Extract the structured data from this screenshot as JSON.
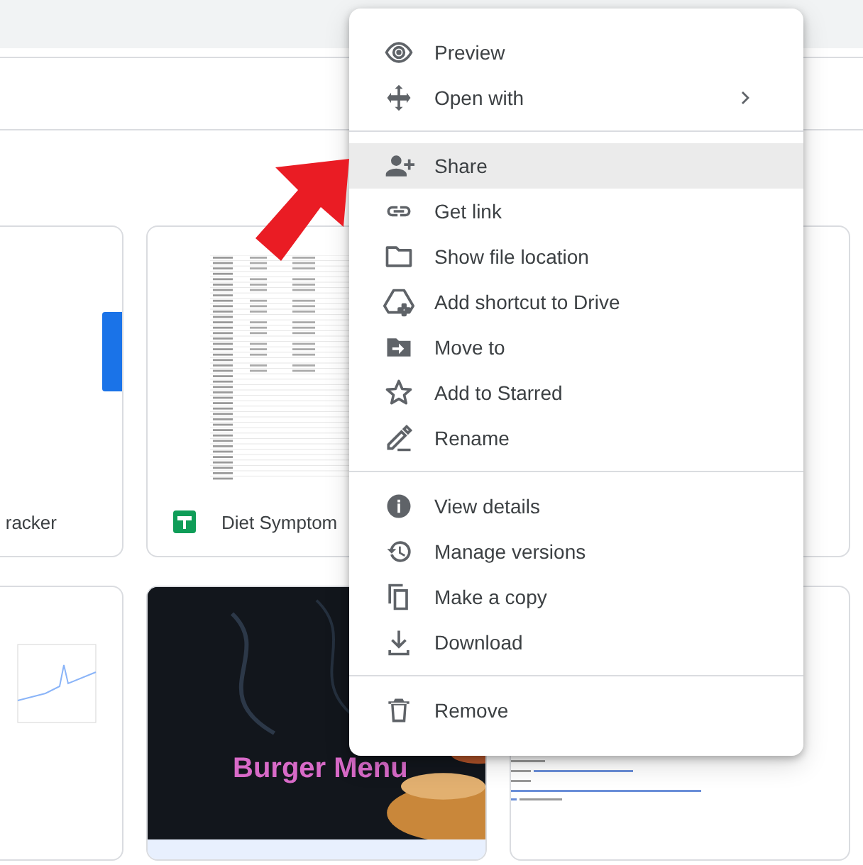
{
  "cards": [
    {
      "caption": "racker",
      "kind": "blank"
    },
    {
      "caption": "Diet Symptom",
      "kind": "sheet"
    },
    {
      "kind": "hidden"
    },
    {
      "kind": "chart"
    },
    {
      "kind": "slides",
      "title": "Burger Menu"
    },
    {
      "kind": "doc"
    }
  ],
  "menu": {
    "groups": [
      [
        {
          "label": "Preview",
          "selected": false,
          "submenu": false
        },
        {
          "label": "Open with",
          "selected": false,
          "submenu": true
        }
      ],
      [
        {
          "label": "Share",
          "selected": true,
          "submenu": false
        },
        {
          "label": "Get link",
          "selected": false,
          "submenu": false
        },
        {
          "label": "Show file location",
          "selected": false,
          "submenu": false
        },
        {
          "label": "Add shortcut to Drive",
          "selected": false,
          "submenu": false
        },
        {
          "label": "Move to",
          "selected": false,
          "submenu": false
        },
        {
          "label": "Add to Starred",
          "selected": false,
          "submenu": false
        },
        {
          "label": "Rename",
          "selected": false,
          "submenu": false
        }
      ],
      [
        {
          "label": "View details",
          "selected": false,
          "submenu": false
        },
        {
          "label": "Manage versions",
          "selected": false,
          "submenu": false
        },
        {
          "label": "Make a copy",
          "selected": false,
          "submenu": false
        },
        {
          "label": "Download",
          "selected": false,
          "submenu": false
        }
      ],
      [
        {
          "label": "Remove",
          "selected": false,
          "submenu": false
        }
      ]
    ]
  }
}
